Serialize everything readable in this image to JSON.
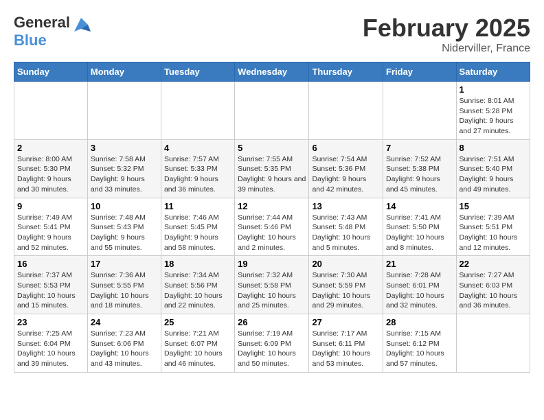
{
  "logo": {
    "general": "General",
    "blue": "Blue"
  },
  "header": {
    "month": "February 2025",
    "location": "Niderviller, France"
  },
  "weekdays": [
    "Sunday",
    "Monday",
    "Tuesday",
    "Wednesday",
    "Thursday",
    "Friday",
    "Saturday"
  ],
  "weeks": [
    [
      {
        "day": "",
        "info": ""
      },
      {
        "day": "",
        "info": ""
      },
      {
        "day": "",
        "info": ""
      },
      {
        "day": "",
        "info": ""
      },
      {
        "day": "",
        "info": ""
      },
      {
        "day": "",
        "info": ""
      },
      {
        "day": "1",
        "info": "Sunrise: 8:01 AM\nSunset: 5:28 PM\nDaylight: 9 hours and 27 minutes."
      }
    ],
    [
      {
        "day": "2",
        "info": "Sunrise: 8:00 AM\nSunset: 5:30 PM\nDaylight: 9 hours and 30 minutes."
      },
      {
        "day": "3",
        "info": "Sunrise: 7:58 AM\nSunset: 5:32 PM\nDaylight: 9 hours and 33 minutes."
      },
      {
        "day": "4",
        "info": "Sunrise: 7:57 AM\nSunset: 5:33 PM\nDaylight: 9 hours and 36 minutes."
      },
      {
        "day": "5",
        "info": "Sunrise: 7:55 AM\nSunset: 5:35 PM\nDaylight: 9 hours and 39 minutes."
      },
      {
        "day": "6",
        "info": "Sunrise: 7:54 AM\nSunset: 5:36 PM\nDaylight: 9 hours and 42 minutes."
      },
      {
        "day": "7",
        "info": "Sunrise: 7:52 AM\nSunset: 5:38 PM\nDaylight: 9 hours and 45 minutes."
      },
      {
        "day": "8",
        "info": "Sunrise: 7:51 AM\nSunset: 5:40 PM\nDaylight: 9 hours and 49 minutes."
      }
    ],
    [
      {
        "day": "9",
        "info": "Sunrise: 7:49 AM\nSunset: 5:41 PM\nDaylight: 9 hours and 52 minutes."
      },
      {
        "day": "10",
        "info": "Sunrise: 7:48 AM\nSunset: 5:43 PM\nDaylight: 9 hours and 55 minutes."
      },
      {
        "day": "11",
        "info": "Sunrise: 7:46 AM\nSunset: 5:45 PM\nDaylight: 9 hours and 58 minutes."
      },
      {
        "day": "12",
        "info": "Sunrise: 7:44 AM\nSunset: 5:46 PM\nDaylight: 10 hours and 2 minutes."
      },
      {
        "day": "13",
        "info": "Sunrise: 7:43 AM\nSunset: 5:48 PM\nDaylight: 10 hours and 5 minutes."
      },
      {
        "day": "14",
        "info": "Sunrise: 7:41 AM\nSunset: 5:50 PM\nDaylight: 10 hours and 8 minutes."
      },
      {
        "day": "15",
        "info": "Sunrise: 7:39 AM\nSunset: 5:51 PM\nDaylight: 10 hours and 12 minutes."
      }
    ],
    [
      {
        "day": "16",
        "info": "Sunrise: 7:37 AM\nSunset: 5:53 PM\nDaylight: 10 hours and 15 minutes."
      },
      {
        "day": "17",
        "info": "Sunrise: 7:36 AM\nSunset: 5:55 PM\nDaylight: 10 hours and 18 minutes."
      },
      {
        "day": "18",
        "info": "Sunrise: 7:34 AM\nSunset: 5:56 PM\nDaylight: 10 hours and 22 minutes."
      },
      {
        "day": "19",
        "info": "Sunrise: 7:32 AM\nSunset: 5:58 PM\nDaylight: 10 hours and 25 minutes."
      },
      {
        "day": "20",
        "info": "Sunrise: 7:30 AM\nSunset: 5:59 PM\nDaylight: 10 hours and 29 minutes."
      },
      {
        "day": "21",
        "info": "Sunrise: 7:28 AM\nSunset: 6:01 PM\nDaylight: 10 hours and 32 minutes."
      },
      {
        "day": "22",
        "info": "Sunrise: 7:27 AM\nSunset: 6:03 PM\nDaylight: 10 hours and 36 minutes."
      }
    ],
    [
      {
        "day": "23",
        "info": "Sunrise: 7:25 AM\nSunset: 6:04 PM\nDaylight: 10 hours and 39 minutes."
      },
      {
        "day": "24",
        "info": "Sunrise: 7:23 AM\nSunset: 6:06 PM\nDaylight: 10 hours and 43 minutes."
      },
      {
        "day": "25",
        "info": "Sunrise: 7:21 AM\nSunset: 6:07 PM\nDaylight: 10 hours and 46 minutes."
      },
      {
        "day": "26",
        "info": "Sunrise: 7:19 AM\nSunset: 6:09 PM\nDaylight: 10 hours and 50 minutes."
      },
      {
        "day": "27",
        "info": "Sunrise: 7:17 AM\nSunset: 6:11 PM\nDaylight: 10 hours and 53 minutes."
      },
      {
        "day": "28",
        "info": "Sunrise: 7:15 AM\nSunset: 6:12 PM\nDaylight: 10 hours and 57 minutes."
      },
      {
        "day": "",
        "info": ""
      }
    ]
  ]
}
